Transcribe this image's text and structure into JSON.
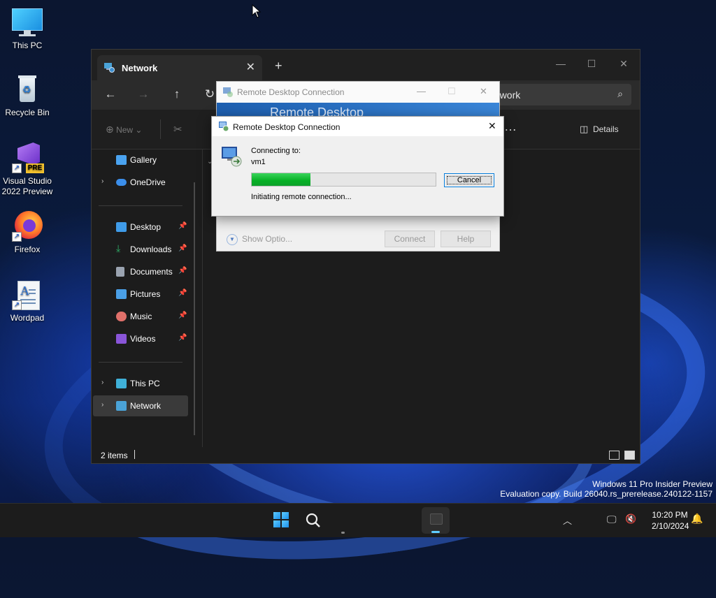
{
  "desktop": {
    "icons": [
      {
        "label": "This PC"
      },
      {
        "label": "Recycle Bin"
      },
      {
        "label": "Visual Studio 2022 Preview",
        "badge": "PRE"
      },
      {
        "label": "Firefox"
      },
      {
        "label": "Wordpad"
      }
    ]
  },
  "explorer": {
    "tab_title": "Network",
    "tab_close": "✕",
    "tab_add": "+",
    "search_text": "etwork",
    "toolbar": {
      "new_label": "New",
      "details_label": "Details",
      "more_label": "…"
    },
    "sidebar": {
      "quick": [
        {
          "label": "Gallery",
          "icon": "gallery-icon",
          "color": "#4aa3f0"
        },
        {
          "label": "OneDrive",
          "icon": "cloud-icon",
          "color": "#3b8eea"
        }
      ],
      "pinned": [
        {
          "label": "Desktop",
          "icon": "desktop-folder-icon",
          "color": "#3f9be8"
        },
        {
          "label": "Downloads",
          "icon": "download-icon",
          "color": "#30b46a"
        },
        {
          "label": "Documents",
          "icon": "document-icon",
          "color": "#9aa3b0"
        },
        {
          "label": "Pictures",
          "icon": "pictures-icon",
          "color": "#4a9fe6"
        },
        {
          "label": "Music",
          "icon": "music-icon",
          "color": "#e0706a"
        },
        {
          "label": "Videos",
          "icon": "video-icon",
          "color": "#8a55d9"
        }
      ],
      "roots": [
        {
          "label": "This PC",
          "icon": "computer-icon",
          "color": "#3fb0d8"
        },
        {
          "label": "Network",
          "icon": "network-icon",
          "color": "#4aa3d8"
        }
      ]
    },
    "status": "2 items"
  },
  "rdp_back": {
    "title": "Remote Desktop Connection",
    "banner_text": "Remote Desktop",
    "show_options": "Show Optio...",
    "connect_label": "Connect",
    "help_label": "Help"
  },
  "rdp_front": {
    "title": "Remote Desktop Connection",
    "close_glyph": "✕",
    "connecting_to": "Connecting to:",
    "host": "vm1",
    "progress_fraction": 0.32,
    "cancel_label": "Cancel",
    "status_text": "Initiating remote connection..."
  },
  "watermark": {
    "line1": "Windows 11 Pro Insider Preview",
    "line2": "Evaluation copy. Build 26040.rs_prerelease.240122-1157"
  },
  "taskbar": {
    "time": "10:20 PM",
    "date": "2/10/2024"
  },
  "colors": {
    "accent": "#0078d7",
    "progress_green": "#06b025"
  }
}
